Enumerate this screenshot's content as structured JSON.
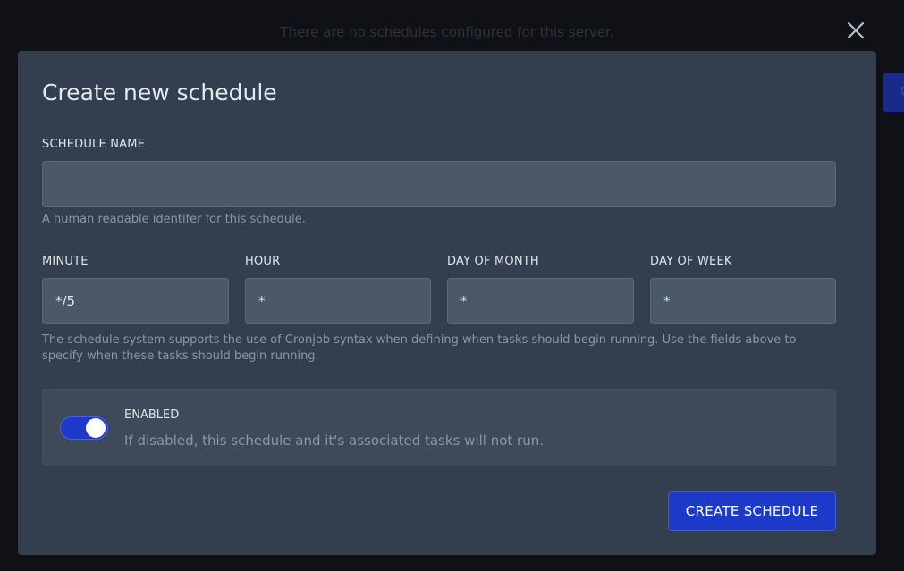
{
  "background": {
    "empty_message": "There are no schedules configured for this server.",
    "partial_button_label": "C"
  },
  "modal": {
    "title": "Create new schedule",
    "close_icon": "close-icon",
    "schedule_name": {
      "label": "SCHEDULE NAME",
      "value": "",
      "placeholder": "",
      "help": "A human readable identifer for this schedule."
    },
    "cron": {
      "minute": {
        "label": "MINUTE",
        "value": "*/5"
      },
      "hour": {
        "label": "HOUR",
        "value": "*"
      },
      "day_of_month": {
        "label": "DAY OF MONTH",
        "value": "*"
      },
      "day_of_week": {
        "label": "DAY OF WEEK",
        "value": "*"
      },
      "help": "The schedule system supports the use of Cronjob syntax when defining when tasks should begin running. Use the fields above to specify when these tasks should begin running."
    },
    "enabled": {
      "label": "ENABLED",
      "description": "If disabled, this schedule and it's associated tasks will not run.",
      "checked": true
    },
    "submit_label": "CREATE SCHEDULE"
  },
  "colors": {
    "modal_bg": "#333f4f",
    "input_bg": "#4a5868",
    "accent": "#1c39c9",
    "backdrop": "#0f1117"
  }
}
